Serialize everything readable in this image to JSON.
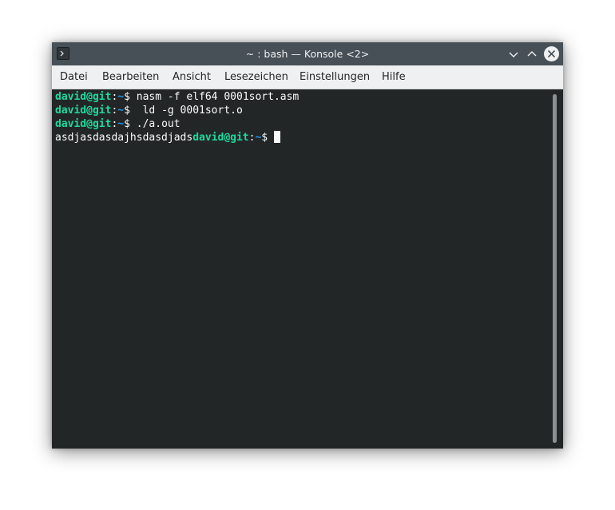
{
  "window": {
    "title": "~ : bash — Konsole <2>"
  },
  "menubar": {
    "items": [
      "Datei",
      "Bearbeiten",
      "Ansicht",
      "Lesezeichen",
      "Einstellungen",
      "Hilfe"
    ]
  },
  "terminal": {
    "prompt_user": "david@git",
    "prompt_colon": ":",
    "prompt_path": "~",
    "prompt_symbol": "$ ",
    "lines": [
      {
        "command": "nasm -f elf64 0001sort.asm"
      },
      {
        "command": " ld -g 0001sort.o"
      },
      {
        "command": "./a.out"
      }
    ],
    "output_line": "asdjasdasdajhsdasdjads"
  },
  "colors": {
    "titlebar": "#475057",
    "menubar": "#eff0f1",
    "terminal_bg": "#232627",
    "prompt_user": "#1cdc9a",
    "prompt_path": "#1d99f3",
    "text": "#fcfcfc"
  },
  "icons": {
    "app": "terminal-icon",
    "minimize": "chevron-down-icon",
    "maximize": "chevron-up-icon",
    "close": "close-icon"
  }
}
